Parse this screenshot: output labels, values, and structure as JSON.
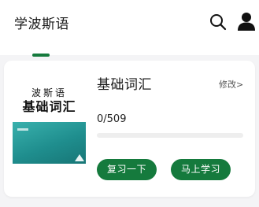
{
  "header": {
    "app_title": "学波斯语",
    "icons": [
      "search-icon",
      "user-icon"
    ]
  },
  "book": {
    "cover": {
      "subtitle": "波斯语",
      "title": "基础词汇"
    },
    "title": "基础词汇",
    "edit_label": "修改>",
    "progress": {
      "text": "0/509",
      "learned": 0,
      "total": 509
    },
    "buttons": {
      "review_label": "复习一下",
      "learn_label": "马上学习"
    }
  },
  "colors": {
    "accent": "#157a3d",
    "cover_teal": "#1f8e8e",
    "background": "#f4f4f6"
  }
}
